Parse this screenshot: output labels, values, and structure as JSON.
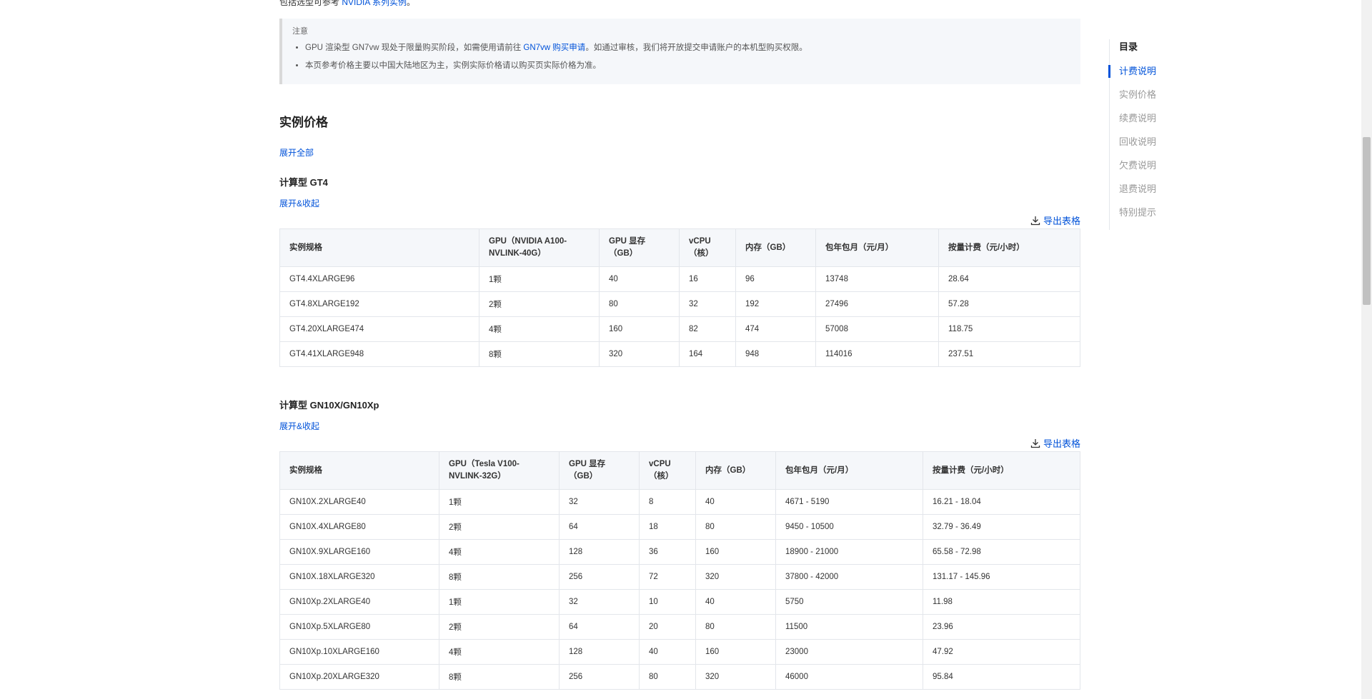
{
  "intro": {
    "prefix": "包括选型可参考 ",
    "link": "NVIDIA 系列实例",
    "suffix": "。"
  },
  "note": {
    "title": "注意",
    "item1_prefix": "GPU 渲染型 GN7vw 现处于限量购买阶段，如需使用请前往 ",
    "item1_link": "GN7vw 购买申请",
    "item1_suffix": "。如通过审核，我们将开放提交申请账户的本机型购买权限。",
    "item2": "本页参考价格主要以中国大陆地区为主，实例实际价格请以购买页实际价格为准。"
  },
  "section_title": "实例价格",
  "expand_all": "展开全部",
  "export_label": "导出表格",
  "toggle_label": "展开&收起",
  "gt4": {
    "title": "计算型 GT4",
    "headers": [
      "实例规格",
      "GPU（NVIDIA A100-NVLINK-40G）",
      "GPU 显存（GB）",
      "vCPU（核）",
      "内存（GB）",
      "包年包月（元/月）",
      "按量计费（元/小时）"
    ],
    "rows": [
      [
        "GT4.4XLARGE96",
        "1颗",
        "40",
        "16",
        "96",
        "13748",
        "28.64"
      ],
      [
        "GT4.8XLARGE192",
        "2颗",
        "80",
        "32",
        "192",
        "27496",
        "57.28"
      ],
      [
        "GT4.20XLARGE474",
        "4颗",
        "160",
        "82",
        "474",
        "57008",
        "118.75"
      ],
      [
        "GT4.41XLARGE948",
        "8颗",
        "320",
        "164",
        "948",
        "114016",
        "237.51"
      ]
    ]
  },
  "gn10": {
    "title": "计算型 GN10X/GN10Xp",
    "headers": [
      "实例规格",
      "GPU（Tesla V100-NVLINK-32G）",
      "GPU 显存（GB）",
      "vCPU（核）",
      "内存（GB）",
      "包年包月（元/月）",
      "按量计费（元/小时）"
    ],
    "rows": [
      [
        "GN10X.2XLARGE40",
        "1颗",
        "32",
        "8",
        "40",
        "4671 - 5190",
        "16.21 - 18.04"
      ],
      [
        "GN10X.4XLARGE80",
        "2颗",
        "64",
        "18",
        "80",
        "9450 - 10500",
        "32.79 - 36.49"
      ],
      [
        "GN10X.9XLARGE160",
        "4颗",
        "128",
        "36",
        "160",
        "18900 - 21000",
        "65.58 - 72.98"
      ],
      [
        "GN10X.18XLARGE320",
        "8颗",
        "256",
        "72",
        "320",
        "37800 - 42000",
        "131.17 - 145.96"
      ],
      [
        "GN10Xp.2XLARGE40",
        "1颗",
        "32",
        "10",
        "40",
        "5750",
        "11.98"
      ],
      [
        "GN10Xp.5XLARGE80",
        "2颗",
        "64",
        "20",
        "80",
        "11500",
        "23.96"
      ],
      [
        "GN10Xp.10XLARGE160",
        "4颗",
        "128",
        "40",
        "160",
        "23000",
        "47.92"
      ],
      [
        "GN10Xp.20XLARGE320",
        "8颗",
        "256",
        "80",
        "320",
        "46000",
        "95.84"
      ]
    ]
  },
  "toc": {
    "title": "目录",
    "items": [
      "计费说明",
      "实例价格",
      "续费说明",
      "回收说明",
      "欠费说明",
      "退费说明",
      "特别提示"
    ],
    "active_index": 0
  },
  "colors": {
    "link": "#0052d9",
    "header_bg": "#f5f7fa",
    "border": "#e3e6eb"
  }
}
